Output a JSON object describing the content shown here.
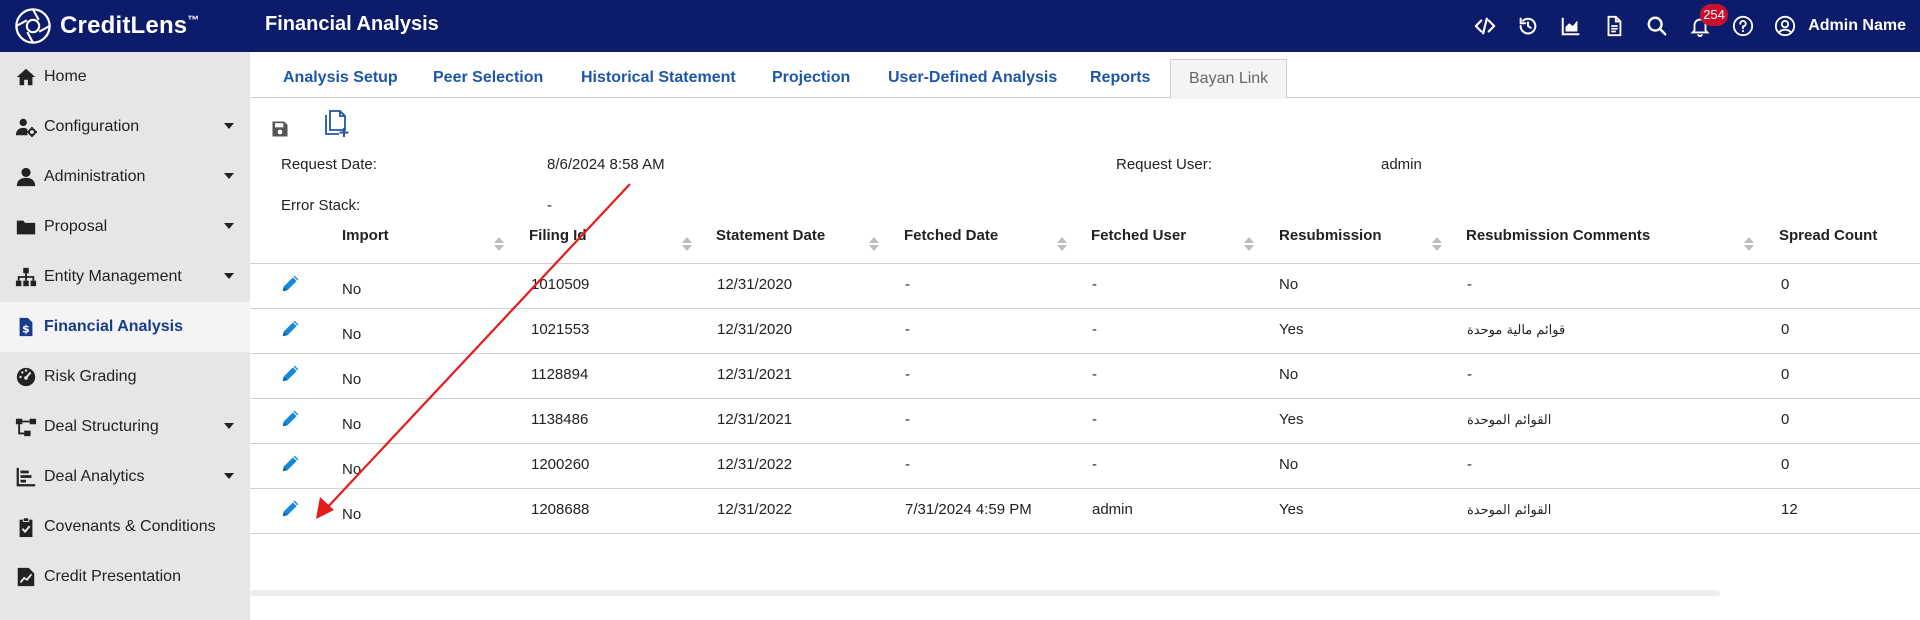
{
  "app": {
    "brand": "CreditLens",
    "brand_mark": "™",
    "page_title": "Financial Analysis",
    "notification_count": "254",
    "user_name": "Admin Name",
    "header_icons": [
      "code-icon",
      "history-icon",
      "chart-icon",
      "document-icon",
      "search-icon",
      "bell-icon",
      "help-icon",
      "user-icon"
    ]
  },
  "sidebar": {
    "items": [
      {
        "label": "Home",
        "icon": "home-icon",
        "has_caret": false
      },
      {
        "label": "Configuration",
        "icon": "user-gear-icon",
        "has_caret": true
      },
      {
        "label": "Administration",
        "icon": "person-icon",
        "has_caret": true
      },
      {
        "label": "Proposal",
        "icon": "folder-icon",
        "has_caret": true
      },
      {
        "label": "Entity Management",
        "icon": "hierarchy-icon",
        "has_caret": true
      },
      {
        "label": "Financial Analysis",
        "icon": "dollar-doc-icon",
        "has_caret": false,
        "active": true
      },
      {
        "label": "Risk Grading",
        "icon": "gauge-icon",
        "has_caret": false
      },
      {
        "label": "Deal Structuring",
        "icon": "flow-icon",
        "has_caret": true
      },
      {
        "label": "Deal Analytics",
        "icon": "bar-chart-icon",
        "has_caret": true
      },
      {
        "label": "Covenants & Conditions",
        "icon": "clipboard-check-icon",
        "has_caret": false
      },
      {
        "label": "Credit Presentation",
        "icon": "chart-doc-icon",
        "has_caret": false
      }
    ]
  },
  "tabs": [
    "Analysis Setup",
    "Peer Selection",
    "Historical Statement",
    "Projection",
    "User-Defined Analysis",
    "Reports",
    "Bayan Link"
  ],
  "active_tab": "Bayan Link",
  "actions": {
    "save_icon": "save-icon",
    "copy_icon": "copy-add-icon"
  },
  "request": {
    "date_label": "Request Date:",
    "date_value": "8/6/2024 8:58 AM",
    "user_label": "Request User:",
    "user_value": "admin",
    "error_label": "Error Stack:",
    "error_value": "-"
  },
  "table": {
    "columns": [
      "Import",
      "Filing Id",
      "Statement Date",
      "Fetched Date",
      "Fetched User",
      "Resubmission",
      "Resubmission Comments",
      "Spread Count"
    ],
    "rows": [
      {
        "import": "No",
        "filing_id": "1010509",
        "statement_date": "12/31/2020",
        "fetched_date": "-",
        "fetched_user": "-",
        "resubmission": "No",
        "comments": "-",
        "spread_count": "0"
      },
      {
        "import": "No",
        "filing_id": "1021553",
        "statement_date": "12/31/2020",
        "fetched_date": "-",
        "fetched_user": "-",
        "resubmission": "Yes",
        "comments": "قوائم مالية موحدة",
        "spread_count": "0"
      },
      {
        "import": "No",
        "filing_id": "1128894",
        "statement_date": "12/31/2021",
        "fetched_date": "-",
        "fetched_user": "-",
        "resubmission": "No",
        "comments": "-",
        "spread_count": "0"
      },
      {
        "import": "No",
        "filing_id": "1138486",
        "statement_date": "12/31/2021",
        "fetched_date": "-",
        "fetched_user": "-",
        "resubmission": "Yes",
        "comments": "القوائم الموحدة",
        "spread_count": "0"
      },
      {
        "import": "No",
        "filing_id": "1200260",
        "statement_date": "12/31/2022",
        "fetched_date": "-",
        "fetched_user": "-",
        "resubmission": "No",
        "comments": "-",
        "spread_count": "0"
      },
      {
        "import": "No",
        "filing_id": "1208688",
        "statement_date": "12/31/2022",
        "fetched_date": "7/31/2024 4:59 PM",
        "fetched_user": "admin",
        "resubmission": "Yes",
        "comments": "القوائم الموحدة",
        "spread_count": "12"
      }
    ]
  },
  "colors": {
    "header_bg": "#0d1b6b",
    "link_blue": "#1e56a8",
    "edit_blue": "#1589d6",
    "annotation_red": "#e41b1b",
    "badge_red": "#c8102e"
  }
}
